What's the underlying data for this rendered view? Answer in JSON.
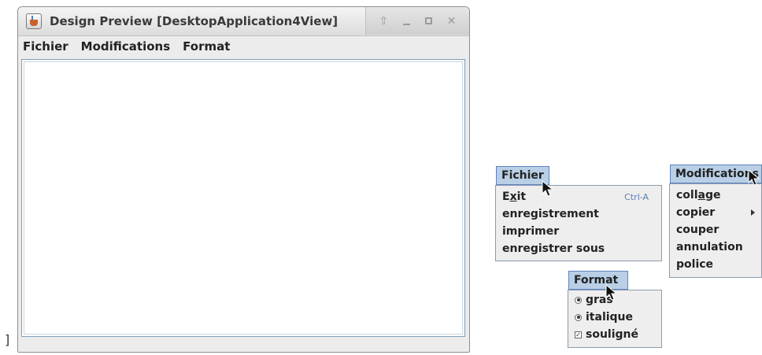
{
  "stray_char": "]",
  "window": {
    "title": "Design Preview [DesktopApplication4View]",
    "menubar": [
      "Fichier",
      "Modifications",
      "Format"
    ]
  },
  "fichier_menu": {
    "header": "Fichier",
    "items": [
      {
        "prefix": "E",
        "mnemonic": "x",
        "suffix": "it",
        "shortcut": "Ctrl-A"
      },
      {
        "label": "enregistrement"
      },
      {
        "label": "imprimer"
      },
      {
        "label": "enregistrer sous"
      }
    ]
  },
  "modifications_menu": {
    "header": "Modifications",
    "items": [
      {
        "prefix": "coll",
        "mnemonic": "a",
        "suffix": "ge"
      },
      {
        "label": "copier",
        "submenu": true
      },
      {
        "label": "couper"
      },
      {
        "label": "annulation"
      },
      {
        "label": "police"
      }
    ]
  },
  "format_menu": {
    "header": "Format",
    "items": [
      {
        "label": "gras",
        "type": "radio",
        "selected": true
      },
      {
        "label": "italique",
        "type": "radio",
        "selected": true
      },
      {
        "label": "souligné",
        "type": "checkbox",
        "checked": true
      }
    ]
  },
  "colors": {
    "menu_header_bg": "#b8cfe5",
    "menu_header_border": "#6382bf",
    "shortcut_text": "#5b7fb4"
  }
}
